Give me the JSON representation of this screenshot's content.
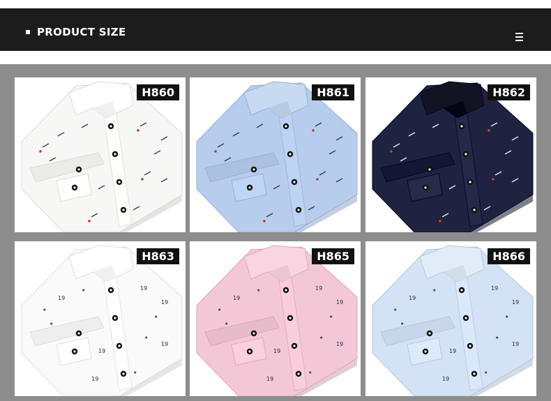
{
  "header": {
    "title": "PRODUCT SIZE",
    "menu_icon": "menu-icon"
  },
  "colors": {
    "header_bg": "#1c1c1c",
    "panel_bg": "#8d8d8d",
    "label_bg": "#111111"
  },
  "products": [
    {
      "code": "H860",
      "fabric": "#f7f7f5",
      "collar": "#ffffff",
      "pattern": "dash",
      "ink": "#2f4661",
      "accent": "#c0392b"
    },
    {
      "code": "H861",
      "fabric": "#b7cdee",
      "collar": "#c8d9f2",
      "pattern": "dash",
      "ink": "#2c3e5c",
      "accent": "#c0392b"
    },
    {
      "code": "H862",
      "fabric": "#1e2342",
      "collar": "#121424",
      "pattern": "dash",
      "ink": "#e8e8e8",
      "accent": "#d84030"
    },
    {
      "code": "H863",
      "fabric": "#fafafa",
      "collar": "#ffffff",
      "pattern": "star",
      "ink": "#1f2a3a",
      "accent": "#1f2a3a"
    },
    {
      "code": "H865",
      "fabric": "#f4c7d6",
      "collar": "#f8d5e0",
      "pattern": "star",
      "ink": "#1f2a3a",
      "accent": "#1f2a3a"
    },
    {
      "code": "H866",
      "fabric": "#d4e2f5",
      "collar": "#e2ebf8",
      "pattern": "star",
      "ink": "#1f2a3a",
      "accent": "#1f2a3a"
    }
  ]
}
